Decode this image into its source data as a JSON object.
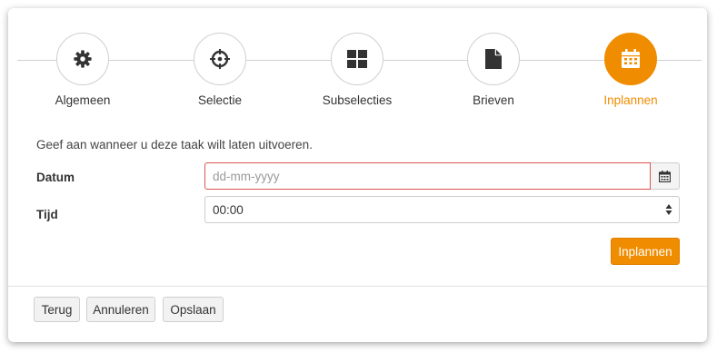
{
  "steps": [
    {
      "label": "Algemeen",
      "icon": "gear-icon"
    },
    {
      "label": "Selectie",
      "icon": "crosshair-icon"
    },
    {
      "label": "Subselecties",
      "icon": "grid-icon"
    },
    {
      "label": "Brieven",
      "icon": "document-icon"
    },
    {
      "label": "Inplannen",
      "icon": "calendar-icon",
      "active": true
    }
  ],
  "form": {
    "intro": "Geef aan wanneer u deze taak wilt laten uitvoeren.",
    "datum_label": "Datum",
    "datum_placeholder": "dd-mm-yyyy",
    "datum_value": "",
    "tijd_label": "Tijd",
    "tijd_value": "00:00",
    "submit_label": "Inplannen"
  },
  "footer": {
    "back_label": "Terug",
    "cancel_label": "Annuleren",
    "save_label": "Opslaan"
  },
  "colors": {
    "accent": "#f08c00",
    "error_border": "#d9534f"
  }
}
